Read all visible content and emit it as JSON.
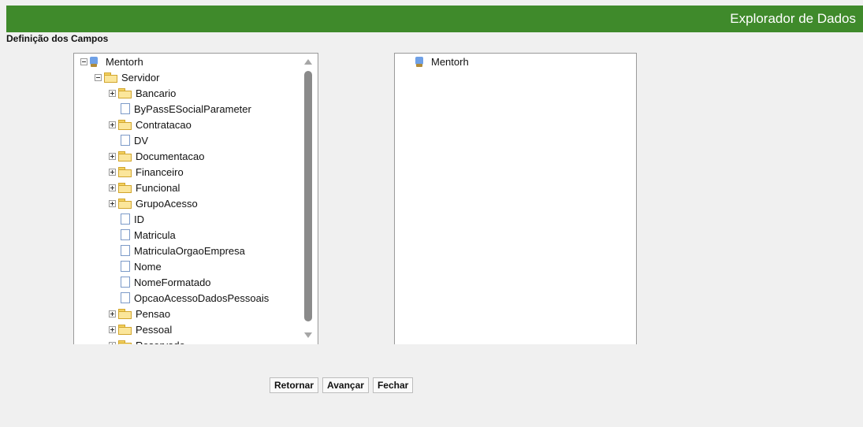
{
  "header": {
    "title": "Explorador de Dados"
  },
  "section_title": "Definição dos Campos",
  "tree": {
    "root": "Mentorh",
    "servidor": "Servidor",
    "children": [
      {
        "label": "Bancario",
        "type": "folder"
      },
      {
        "label": "ByPassESocialParameter",
        "type": "file"
      },
      {
        "label": "Contratacao",
        "type": "folder"
      },
      {
        "label": "DV",
        "type": "file"
      },
      {
        "label": "Documentacao",
        "type": "folder"
      },
      {
        "label": "Financeiro",
        "type": "folder"
      },
      {
        "label": "Funcional",
        "type": "folder"
      },
      {
        "label": "GrupoAcesso",
        "type": "folder"
      },
      {
        "label": "ID",
        "type": "file"
      },
      {
        "label": "Matricula",
        "type": "file"
      },
      {
        "label": "MatriculaOrgaoEmpresa",
        "type": "file"
      },
      {
        "label": "Nome",
        "type": "file"
      },
      {
        "label": "NomeFormatado",
        "type": "file"
      },
      {
        "label": "OpcaoAcessoDadosPessoais",
        "type": "file"
      },
      {
        "label": "Pensao",
        "type": "folder"
      },
      {
        "label": "Pessoal",
        "type": "folder"
      },
      {
        "label": "Reservado",
        "type": "folder"
      }
    ]
  },
  "result": {
    "root": "Mentorh"
  },
  "buttons": {
    "back": "Retornar",
    "next": "Avançar",
    "close": "Fechar"
  }
}
